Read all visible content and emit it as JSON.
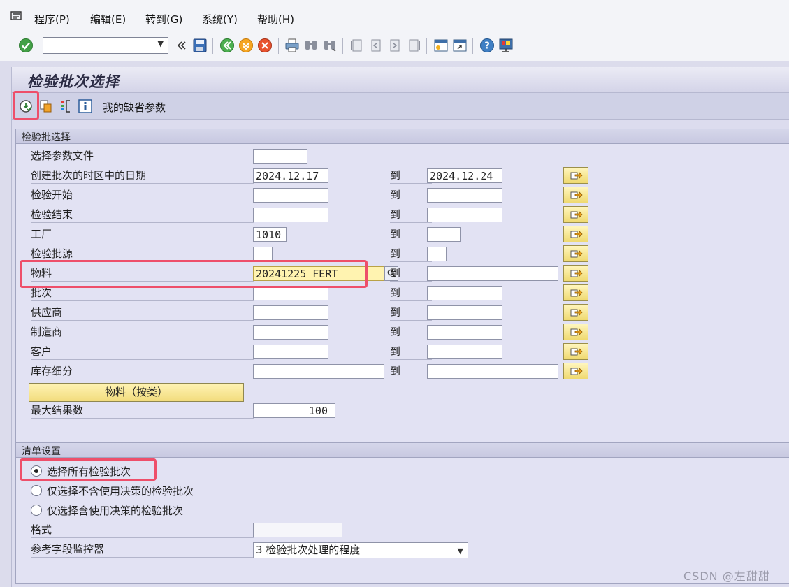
{
  "menu": {
    "items": [
      {
        "label": "程序(",
        "key": "P",
        "tail": ")"
      },
      {
        "label": "编辑(",
        "key": "E",
        "tail": ")"
      },
      {
        "label": "转到(",
        "key": "G",
        "tail": ")"
      },
      {
        "label": "系统(",
        "key": "Y",
        "tail": ")"
      },
      {
        "label": "帮助(",
        "key": "H",
        "tail": ")"
      }
    ]
  },
  "toolbar": {
    "command_value": "",
    "icons": [
      "confirm-icon",
      "command-dropdown-icon",
      "collapse-icon",
      "save-icon",
      "back-icon",
      "exit-icon",
      "cancel-icon",
      "print-icon",
      "find-icon",
      "find-next-icon",
      "first-page-icon",
      "prev-page-icon",
      "next-page-icon",
      "last-page-icon",
      "new-session-icon",
      "shortcut-icon",
      "help-icon",
      "customize-layout-icon"
    ]
  },
  "page": {
    "title": "检验批次选择"
  },
  "app_toolbar": {
    "icons": [
      "execute-icon",
      "get-variant-icon",
      "variant-list-icon",
      "info-icon"
    ],
    "default_params_label": "我的缺省参数"
  },
  "selection": {
    "group_title": "检验批选择",
    "to_label": "到",
    "rows": [
      {
        "label": "选择参数文件",
        "from": ""
      },
      {
        "label": "创建批次的时区中的日期",
        "from": "2024.12.17",
        "to": "2024.12.24"
      },
      {
        "label": "检验开始",
        "from": "",
        "to": ""
      },
      {
        "label": "检验结束",
        "from": "",
        "to": ""
      },
      {
        "label": "工厂",
        "from": "1010",
        "to": ""
      },
      {
        "label": "检验批源",
        "from": "",
        "to": ""
      },
      {
        "label": "物料",
        "from": "20241225_FERT",
        "to": ""
      },
      {
        "label": "批次",
        "from": "",
        "to": ""
      },
      {
        "label": "供应商",
        "from": "",
        "to": ""
      },
      {
        "label": "制造商",
        "from": "",
        "to": ""
      },
      {
        "label": "客户",
        "from": "",
        "to": ""
      },
      {
        "label": "库存细分",
        "from": "",
        "to": ""
      }
    ],
    "material_by_class_button": "物料（按类）",
    "max_results_label": "最大结果数",
    "max_results_value": "100"
  },
  "list_settings": {
    "group_title": "清单设置",
    "radios": [
      {
        "label": "选择所有检验批次",
        "selected": true
      },
      {
        "label": "仅选择不含使用决策的检验批次",
        "selected": false
      },
      {
        "label": "仅选择含使用决策的检验批次",
        "selected": false
      }
    ],
    "format_label": "格式",
    "format_value": "",
    "field_monitor_label": "参考字段监控器",
    "field_monitor_value": "3 检验批次处理的程度"
  },
  "watermark": "CSDN @左甜甜",
  "colors": {
    "highlight": "#ee4f6a",
    "accent_yellow": "#f2dc7d",
    "frame": "#dcdcee"
  }
}
